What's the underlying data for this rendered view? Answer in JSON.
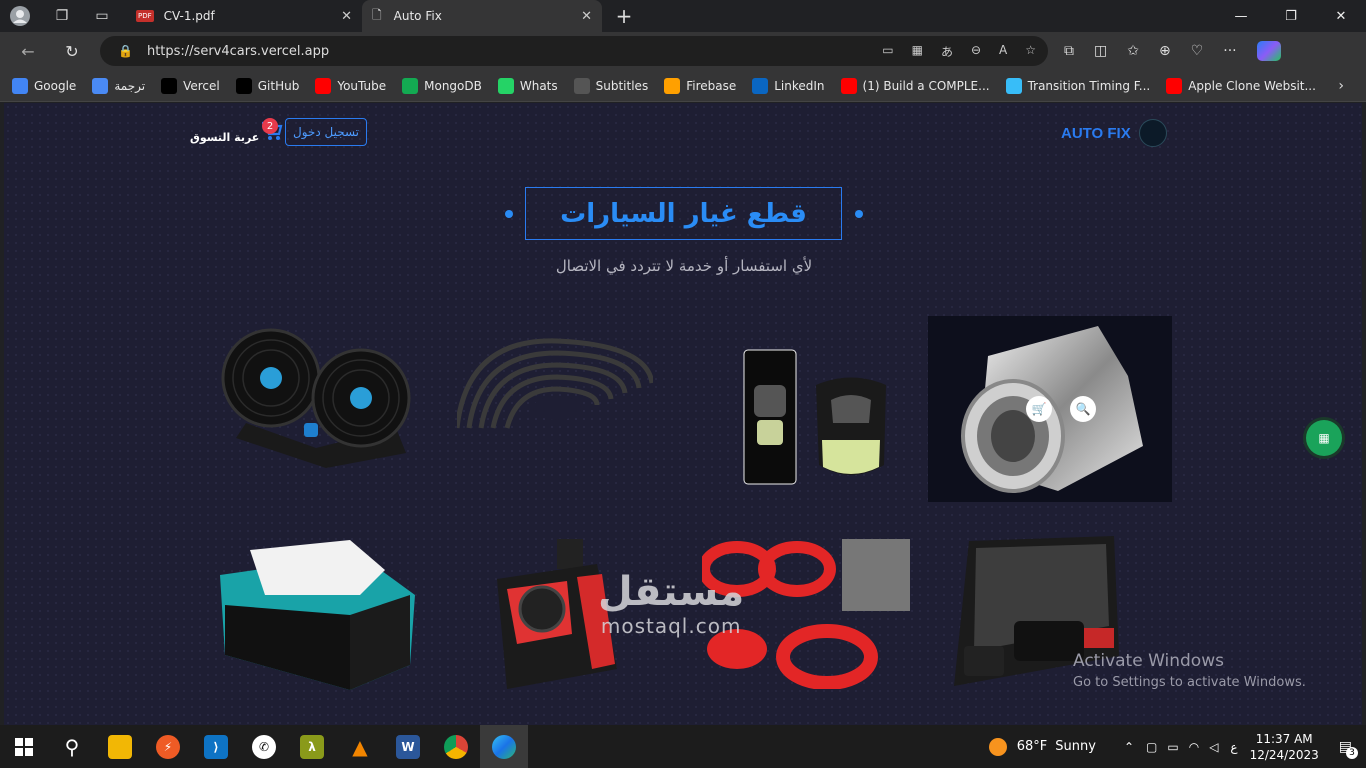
{
  "browser": {
    "tabs": [
      {
        "title": "CV-1.pdf",
        "icon": "pdf-icon"
      },
      {
        "title": "Auto Fix",
        "icon": "page-icon",
        "active": true
      }
    ],
    "url": "https://serv4cars.vercel.app",
    "bookmarks": [
      {
        "label": "Google",
        "icon": "google-icon",
        "color": "#4285f4"
      },
      {
        "label": "ترجمة",
        "icon": "translate-icon",
        "color": "#4a8af4"
      },
      {
        "label": "Vercel",
        "icon": "vercel-icon",
        "color": "#000000"
      },
      {
        "label": "GitHub",
        "icon": "github-icon",
        "color": "#000000"
      },
      {
        "label": "YouTube",
        "icon": "youtube-icon",
        "color": "#ff0000"
      },
      {
        "label": "MongoDB",
        "icon": "mongodb-icon",
        "color": "#13aa52"
      },
      {
        "label": "Whats",
        "icon": "whatsapp-icon",
        "color": "#25d366"
      },
      {
        "label": "Subtitles",
        "icon": "subtitles-icon",
        "color": "#555555"
      },
      {
        "label": "Firebase",
        "icon": "firebase-icon",
        "color": "#ffa000"
      },
      {
        "label": "LinkedIn",
        "icon": "linkedin-icon",
        "color": "#0a66c2"
      },
      {
        "label": "(1) Build a COMPLE...",
        "icon": "youtube-icon",
        "color": "#ff0000"
      },
      {
        "label": "Transition Timing F...",
        "icon": "tailwind-icon",
        "color": "#38bdf8"
      },
      {
        "label": "Apple Clone Websit...",
        "icon": "youtube-icon",
        "color": "#ff0000"
      }
    ]
  },
  "site": {
    "logo_text": "AUTO FIX",
    "login_label": "تسجيل دخول",
    "cart_label": "عربة التسوق",
    "cart_count": "2",
    "title": "قطع غيار السيارات",
    "subtitle": "لأي استفسار أو خدمة لا تتردد في الاتصال",
    "products": [
      {
        "name": "car-fan",
        "icon": "fan-icon"
      },
      {
        "name": "door-seal-strip",
        "icon": "strip-icon"
      },
      {
        "name": "car-air-freshener",
        "icon": "freshener-icon"
      },
      {
        "name": "exhaust-tip",
        "icon": "exhaust-icon"
      },
      {
        "name": "battery-pack",
        "icon": "battery-icon"
      },
      {
        "name": "power-inverter",
        "icon": "inverter-icon"
      },
      {
        "name": "spring-buffer",
        "icon": "spring-icon"
      },
      {
        "name": "tire-inflator-kit",
        "icon": "compressor-icon"
      }
    ]
  },
  "overlay": {
    "activate_title": "Activate Windows",
    "activate_sub": "Go to Settings to activate Windows.",
    "watermark_ar": "مستقل",
    "watermark_en": "mostaql.com"
  },
  "taskbar": {
    "weather_temp": "68°F",
    "weather_desc": "Sunny",
    "lang": "ع",
    "time": "11:37 AM",
    "date": "12/24/2023",
    "notifications": "3"
  }
}
